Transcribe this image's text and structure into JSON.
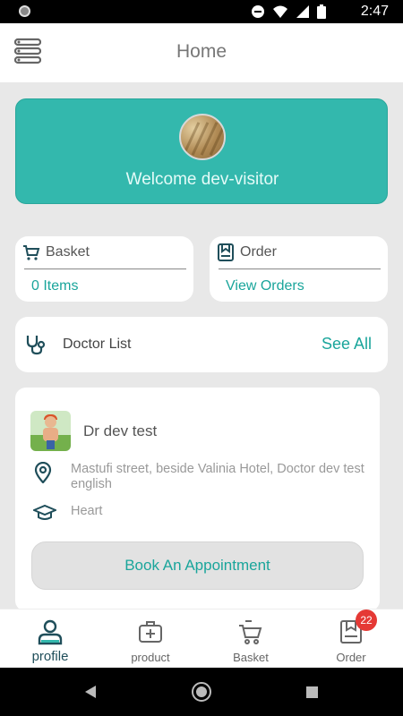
{
  "status_bar": {
    "time": "2:47"
  },
  "header": {
    "title": "Home"
  },
  "welcome": {
    "text": "Welcome dev-visitor"
  },
  "basket_card": {
    "label": "Basket",
    "value": "0 Items"
  },
  "order_card": {
    "label": "Order",
    "value": "View Orders"
  },
  "doctor_list": {
    "label": "Doctor List",
    "see_all": "See All"
  },
  "doctor": {
    "name": "Dr dev test",
    "address": "Mastufi street, beside Valinia Hotel, Doctor dev test english",
    "specialty": "Heart",
    "book_label": "Book An Appointment"
  },
  "bottom_nav": {
    "items": [
      {
        "label": "profile",
        "icon": "profile-icon",
        "active": true
      },
      {
        "label": "product",
        "icon": "medkit-icon",
        "active": false
      },
      {
        "label": "Basket",
        "icon": "cart-icon",
        "active": false
      },
      {
        "label": "Order",
        "icon": "order-icon",
        "active": false
      }
    ],
    "order_badge": "22"
  },
  "colors": {
    "accent": "#33b8ad",
    "accent_text": "#1aa59b",
    "badge": "#e53935"
  }
}
